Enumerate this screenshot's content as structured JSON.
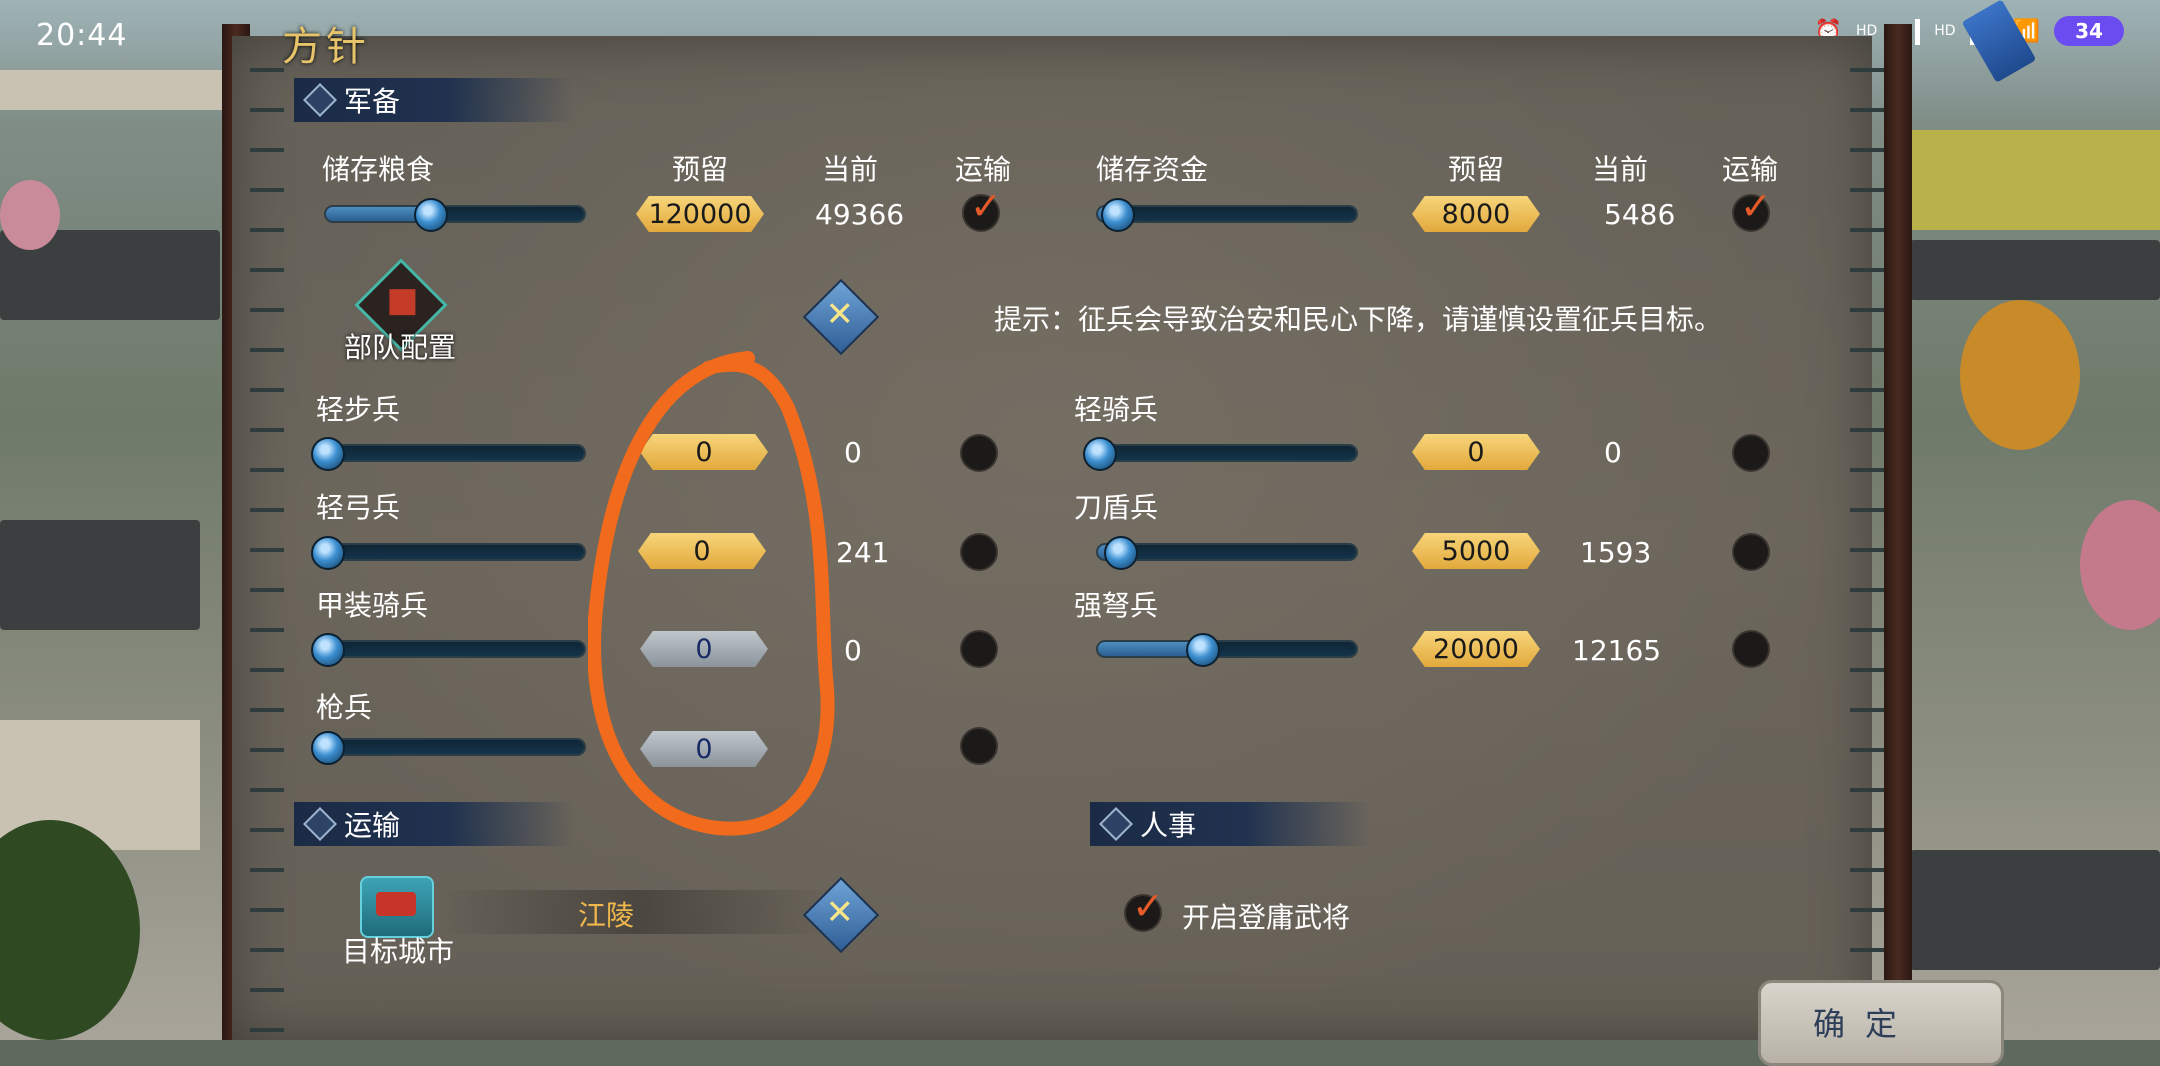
{
  "status": {
    "time": "20:44",
    "battery": "34",
    "hd1": "HD",
    "hd2": "HD"
  },
  "panel": {
    "title": "方针",
    "confirm": "确定"
  },
  "military": {
    "header": "军备",
    "grain": {
      "label": "储存粮食",
      "reserve_label": "预留",
      "current_label": "当前",
      "transport_label": "运输",
      "reserve": "120000",
      "current": "49366",
      "slider": 0.4,
      "transport": true
    },
    "funds": {
      "label": "储存资金",
      "reserve_label": "预留",
      "current_label": "当前",
      "transport_label": "运输",
      "reserve": "8000",
      "current": "5486",
      "slider": 0.07,
      "transport": true
    },
    "squad_label": "部队配置",
    "tip": "提示：征兵会导致治安和民心下降，请谨慎设置征兵目标。",
    "units_left": [
      {
        "name": "轻步兵",
        "target": "0",
        "current": "0",
        "slider": 0.0,
        "enabled": true
      },
      {
        "name": "轻弓兵",
        "target": "0",
        "current": "241",
        "slider": 0.0,
        "enabled": true
      },
      {
        "name": "甲装骑兵",
        "target": "0",
        "current": "0",
        "slider": 0.0,
        "enabled": false
      },
      {
        "name": "枪兵",
        "target": "0",
        "current": "",
        "slider": 0.0,
        "enabled": false
      }
    ],
    "units_right": [
      {
        "name": "轻骑兵",
        "target": "0",
        "current": "0",
        "slider": 0.0,
        "enabled": true
      },
      {
        "name": "刀盾兵",
        "target": "5000",
        "current": "1593",
        "slider": 0.08,
        "enabled": true
      },
      {
        "name": "强弩兵",
        "target": "20000",
        "current": "12165",
        "slider": 0.4,
        "enabled": true
      }
    ]
  },
  "transport": {
    "header": "运输",
    "target_city_label": "目标城市",
    "city": "江陵"
  },
  "personnel": {
    "header": "人事",
    "recruit_label": "开启登庸武将",
    "recruit_enabled": true
  },
  "icons": {
    "squad": "squad-flag-icon",
    "swap": "crossed-swords-icon",
    "city": "city-gate-icon",
    "check": "check-icon",
    "annotation": "orange-hand-drawn-circle"
  }
}
